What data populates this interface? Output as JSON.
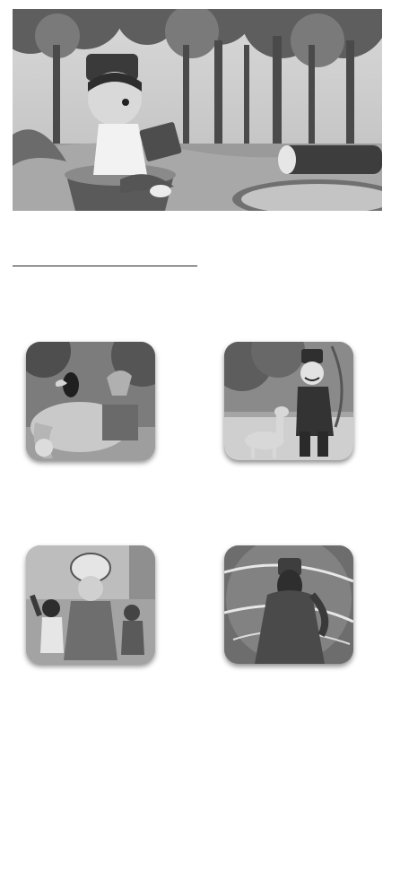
{
  "hero": {
    "illustration": "boy-reading-book-in-forest"
  },
  "stories": [
    {
      "illustration": "toucan-elephant-jungle-scene",
      "icon": "story-thumbnail"
    },
    {
      "illustration": "hunter-and-deer-scene",
      "icon": "story-thumbnail"
    },
    {
      "illustration": "royal-procession-scene",
      "icon": "story-thumbnail"
    },
    {
      "illustration": "veiled-figure-in-storm-scene",
      "icon": "story-thumbnail"
    }
  ],
  "colors": {
    "background": "#ffffff",
    "divider": "#222222"
  }
}
